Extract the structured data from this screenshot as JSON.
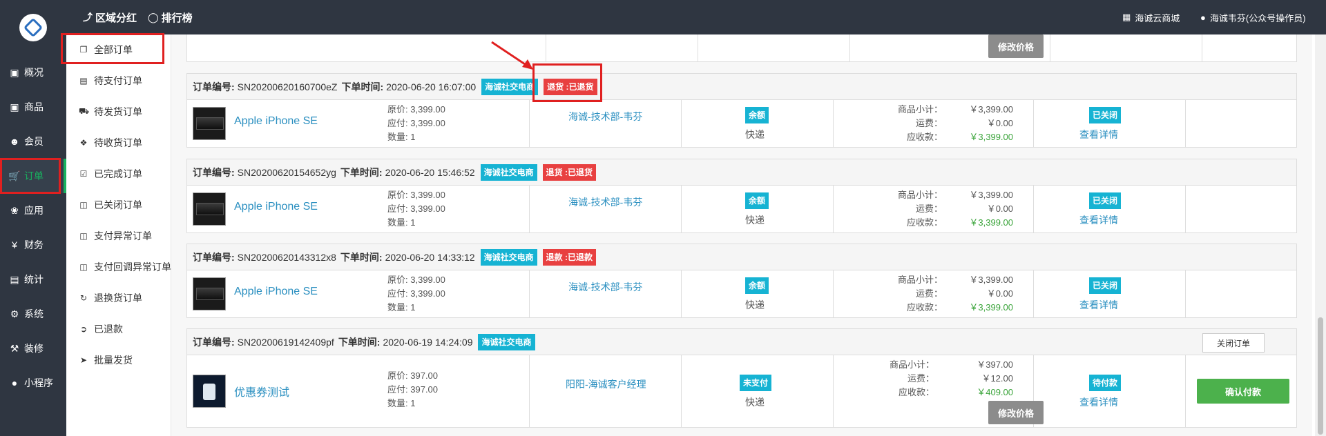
{
  "topbar": {
    "nav": [
      {
        "icon": "pin-icon",
        "label": "区域分红"
      },
      {
        "icon": "circle-icon",
        "label": "排行榜"
      }
    ],
    "mall_link": "海诚云商城",
    "user": "海诚韦芬(公众号操作员)"
  },
  "sidebar": {
    "items": [
      {
        "icon": "overview-icon",
        "label": "概况"
      },
      {
        "icon": "goods-icon",
        "label": "商品"
      },
      {
        "icon": "members-icon",
        "label": "会员"
      },
      {
        "icon": "cart-icon",
        "label": "订单",
        "active": true
      },
      {
        "icon": "apps-icon",
        "label": "应用"
      },
      {
        "icon": "yen-icon",
        "label": "财务"
      },
      {
        "icon": "stats-icon",
        "label": "统计"
      },
      {
        "icon": "settings-icon",
        "label": "系统"
      },
      {
        "icon": "hammer-icon",
        "label": "装修"
      },
      {
        "icon": "wechat-icon",
        "label": "小程序"
      }
    ]
  },
  "submenu": {
    "items": [
      {
        "icon": "copy-icon",
        "label": "全部订单",
        "active": true
      },
      {
        "icon": "credit-card-icon",
        "label": "待支付订单"
      },
      {
        "icon": "truck-icon",
        "label": "待发货订单"
      },
      {
        "icon": "box-icon",
        "label": "待收货订单"
      },
      {
        "icon": "check-square-icon",
        "label": "已完成订单"
      },
      {
        "icon": "trash-icon",
        "label": "已关闭订单"
      },
      {
        "icon": "trash-icon",
        "label": "支付异常订单"
      },
      {
        "icon": "trash-icon",
        "label": "支付回调异常订单"
      },
      {
        "icon": "refresh-icon",
        "label": "退换货订单"
      },
      {
        "icon": "share-icon",
        "label": "已退款"
      },
      {
        "icon": "send-icon",
        "label": "批量发货"
      }
    ]
  },
  "labels": {
    "order_no": "订单编号:",
    "order_time": "下单时间:",
    "original_price": "原价:",
    "payable": "应付:",
    "quantity": "数量:",
    "subtotal": "商品小计：",
    "freight": "运费：",
    "receivable": "应收款：",
    "view_detail": "查看详情",
    "modify_price": "修改价格",
    "close_order": "关闭订单",
    "confirm_payment": "确认付款"
  },
  "orders": [
    {
      "order_no": "SN20200620160700eZ",
      "time": "2020-06-20 16:07:00",
      "channel": "海诚社交电商",
      "refund_tag": "退货 :已退货",
      "product": "Apple iPhone SE",
      "original_price": "3,399.00",
      "payable": "3,399.00",
      "quantity": "1",
      "staff": "海诚-技术部-韦芬",
      "pay_type": "余额",
      "shipping": "快递",
      "subtotal": "￥3,399.00",
      "freight": "￥0.00",
      "receivable": "￥3,399.00",
      "status": "已关闭"
    },
    {
      "order_no": "SN20200620154652yg",
      "time": "2020-06-20 15:46:52",
      "channel": "海诚社交电商",
      "refund_tag": "退货 :已退货",
      "product": "Apple iPhone SE",
      "original_price": "3,399.00",
      "payable": "3,399.00",
      "quantity": "1",
      "staff": "海诚-技术部-韦芬",
      "pay_type": "余额",
      "shipping": "快递",
      "subtotal": "￥3,399.00",
      "freight": "￥0.00",
      "receivable": "￥3,399.00",
      "status": "已关闭"
    },
    {
      "order_no": "SN20200620143312x8",
      "time": "2020-06-20 14:33:12",
      "channel": "海诚社交电商",
      "refund_tag": "退款 :已退款",
      "product": "Apple iPhone SE",
      "original_price": "3,399.00",
      "payable": "3,399.00",
      "quantity": "1",
      "staff": "海诚-技术部-韦芬",
      "pay_type": "余额",
      "shipping": "快递",
      "subtotal": "￥3,399.00",
      "freight": "￥0.00",
      "receivable": "￥3,399.00",
      "status": "已关闭"
    },
    {
      "order_no": "SN20200619142409pf",
      "time": "2020-06-19 14:24:09",
      "channel": "海诚社交电商",
      "product": "优惠券测试",
      "original_price": "397.00",
      "payable": "397.00",
      "quantity": "1",
      "staff": "阳阳-海诚客户经理",
      "pay_type": "未支付",
      "shipping": "快递",
      "subtotal": "￥397.00",
      "freight": "￥12.00",
      "receivable": "￥409.00",
      "status": "待付款"
    }
  ]
}
